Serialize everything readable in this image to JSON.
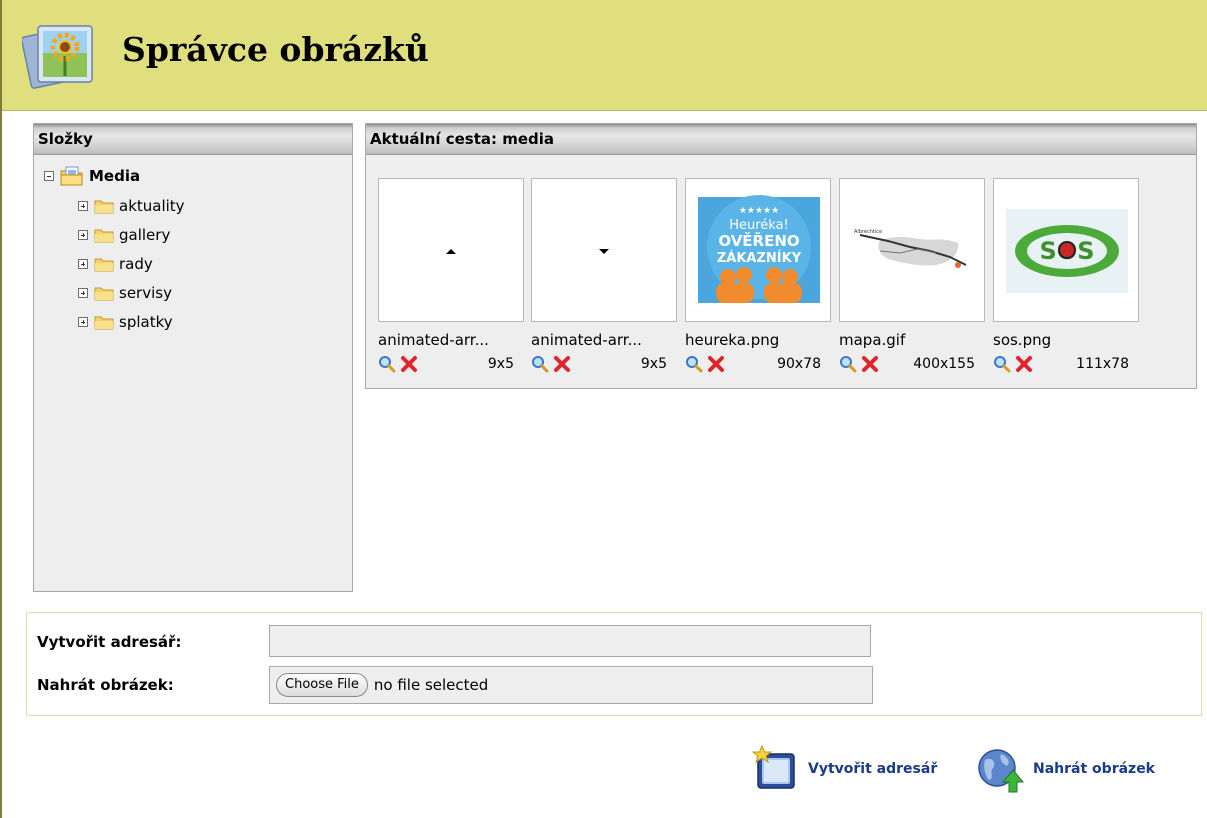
{
  "header": {
    "title": "Správce obrázků",
    "icon": "picture-manager-icon"
  },
  "folders_panel": {
    "title": "Složky",
    "root": {
      "label": "Media",
      "icon": "media-folder-icon"
    },
    "items": [
      {
        "label": "aktuality"
      },
      {
        "label": "gallery"
      },
      {
        "label": "rady"
      },
      {
        "label": "servisy"
      },
      {
        "label": "splatky"
      }
    ]
  },
  "files_panel": {
    "title": "Aktuální cesta: media",
    "files": [
      {
        "name": "animated-arr...",
        "dims": "9x5",
        "thumb": "arrow-up-icon"
      },
      {
        "name": "animated-arr...",
        "dims": "9x5",
        "thumb": "arrow-down-icon"
      },
      {
        "name": "heureka.png",
        "dims": "90x78",
        "thumb": "heureka-badge",
        "badge_text": [
          "Heuréka!",
          "OVĚŘENO",
          "ZÁKAZNÍKY"
        ]
      },
      {
        "name": "mapa.gif",
        "dims": "400x155",
        "thumb": "map-image"
      },
      {
        "name": "sos.png",
        "dims": "111x78",
        "thumb": "sos-logo",
        "logo_text": "SOS"
      }
    ]
  },
  "form": {
    "create_dir_label": "Vytvořit adresář:",
    "create_dir_value": "",
    "upload_label": "Nahrát obrázek:",
    "choose_file_label": "Choose File",
    "no_file_text": "no file selected"
  },
  "actions": {
    "create_dir": "Vytvořit adresář",
    "upload": "Nahrát obrázek"
  },
  "colors": {
    "header_bg": "#dfdf7e",
    "panel_bg": "#eeeeee",
    "link": "#1a3a8a",
    "delete": "#e0242a"
  }
}
